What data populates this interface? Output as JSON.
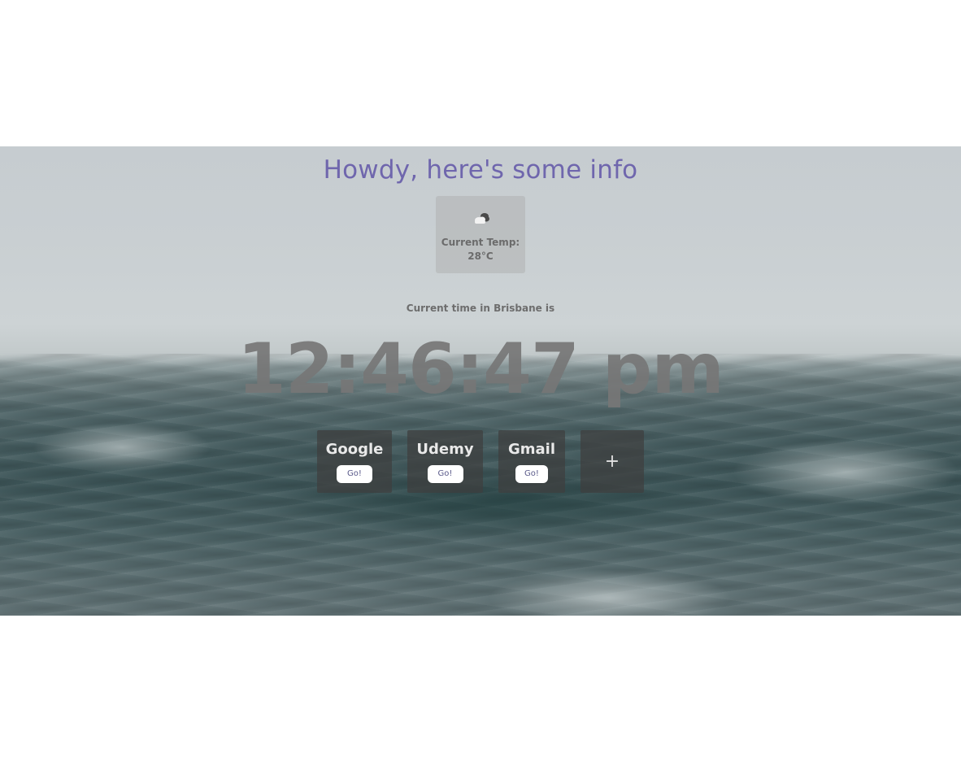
{
  "page": {
    "title": "Howdy, here's some info"
  },
  "weather": {
    "icon": "cloud-night-icon",
    "temp_label": "Current Temp:",
    "temp_value": "28°C"
  },
  "clock": {
    "caption": "Current time in Brisbane is",
    "time": "12:46:47 pm"
  },
  "shortcuts": [
    {
      "name": "Google",
      "button": "Go!"
    },
    {
      "name": "Udemy",
      "button": "Go!"
    },
    {
      "name": "Gmail",
      "button": "Go!"
    }
  ],
  "add_shortcut": {
    "label": "+"
  },
  "colors": {
    "title": "#6f66ad",
    "clock": "#767676",
    "card": "#3e3e3e"
  }
}
